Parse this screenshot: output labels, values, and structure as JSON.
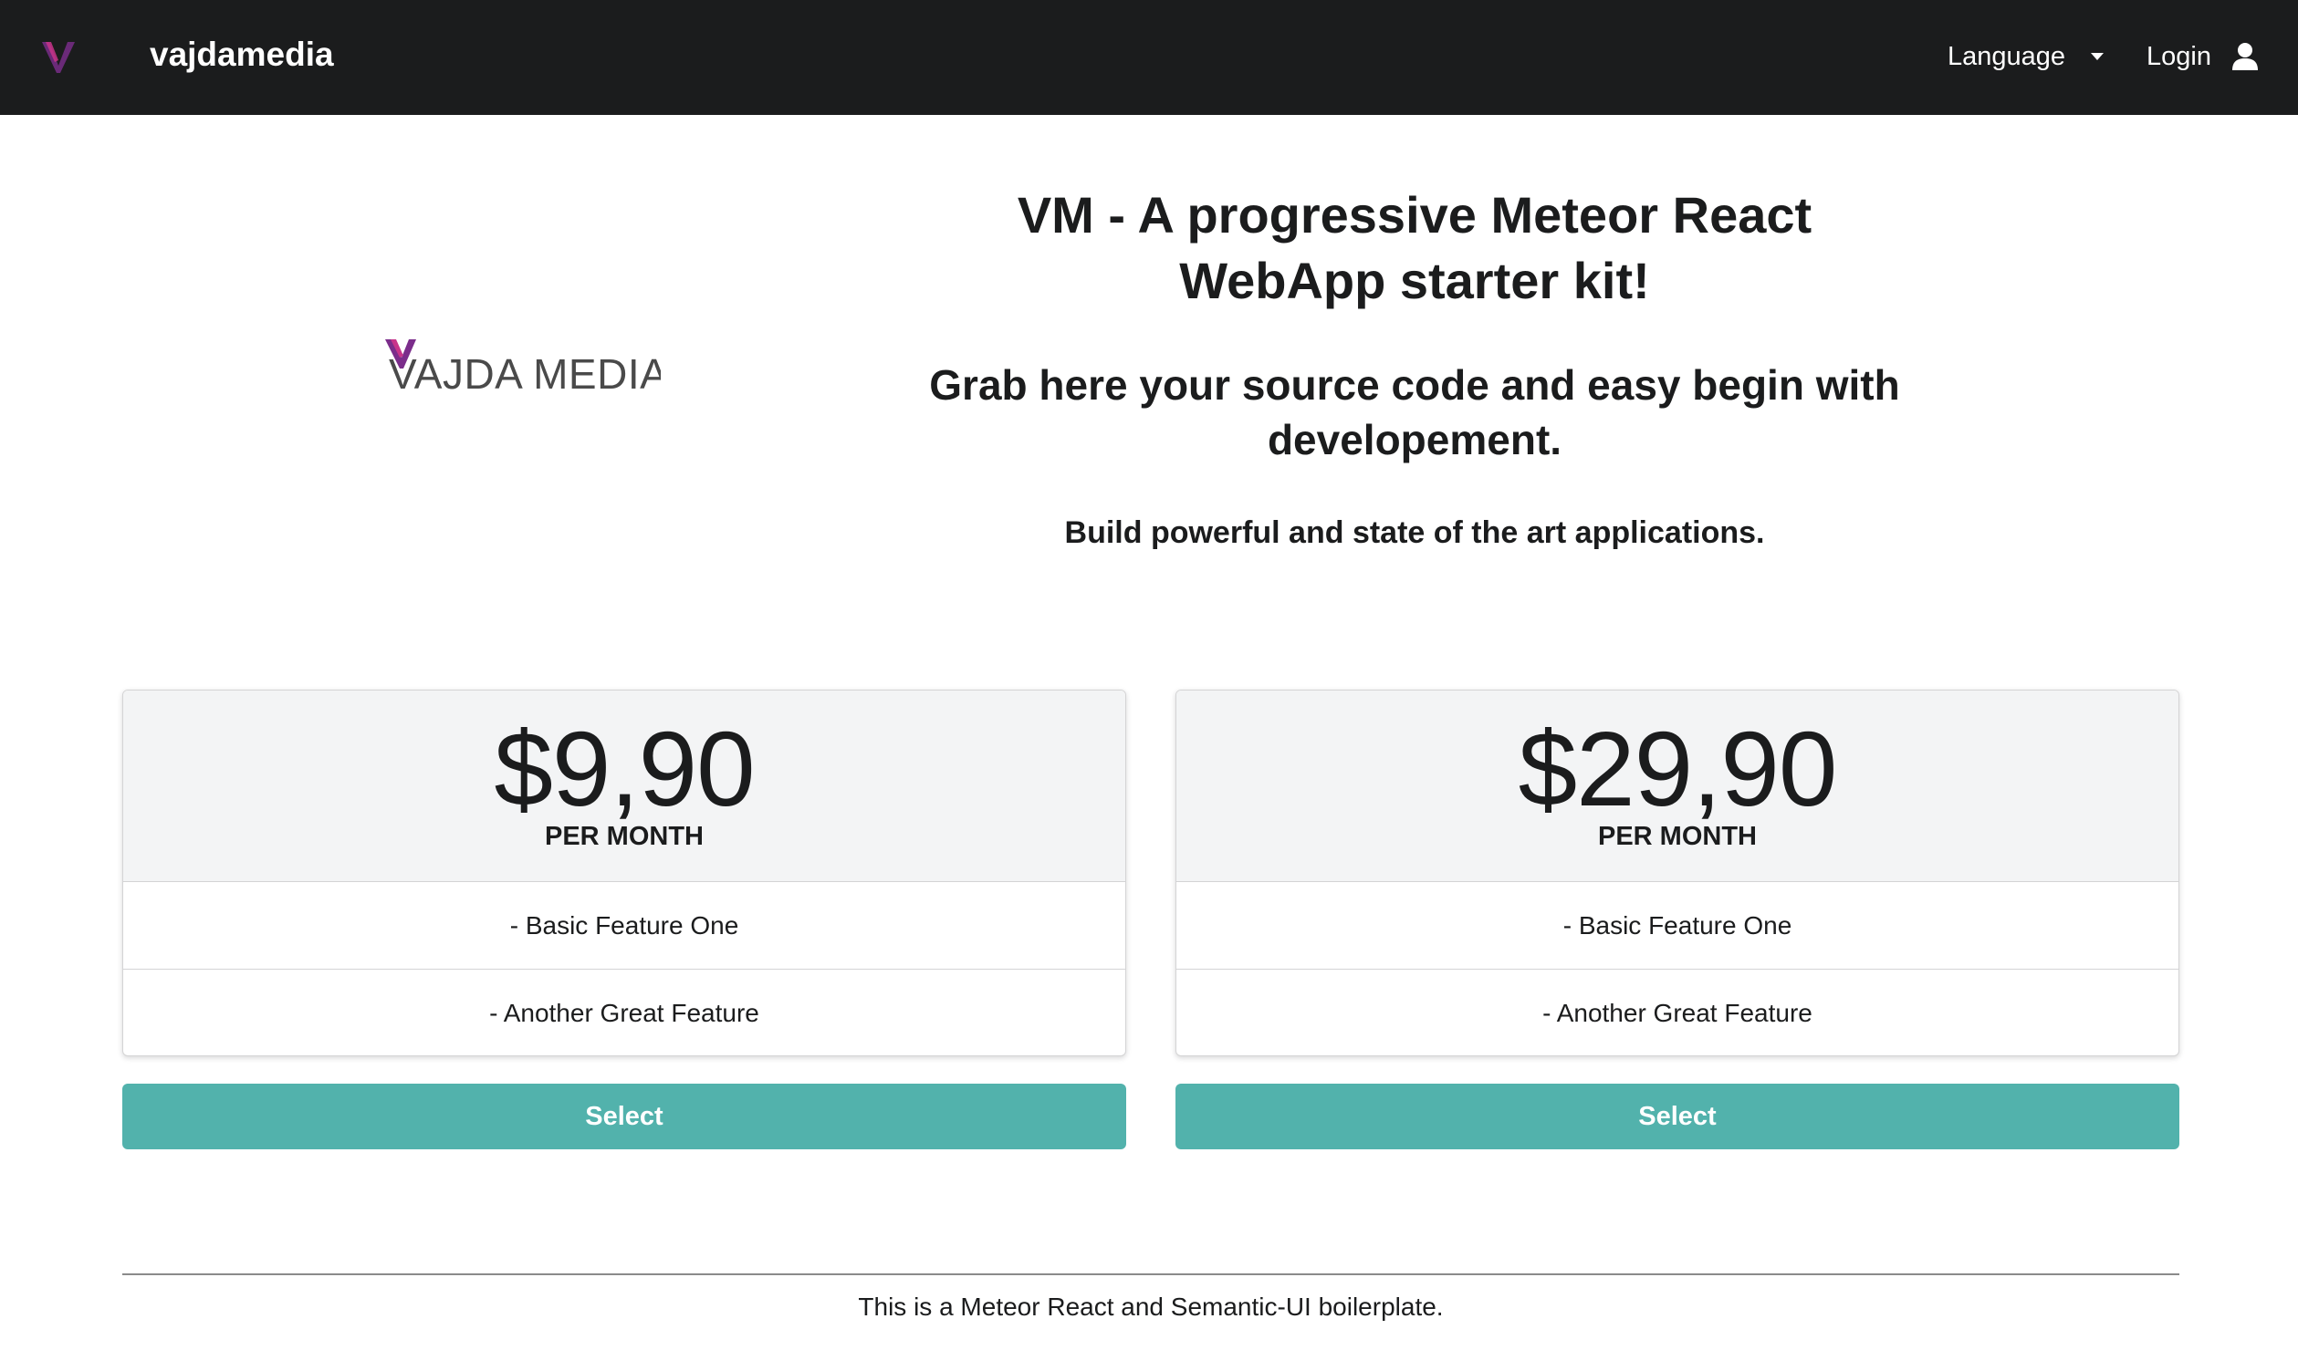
{
  "navbar": {
    "logo_icon": "vm-logo-icon",
    "brand": "vajdamedia",
    "language_label": "Language",
    "language_icon": "caret-down-icon",
    "login_label": "Login",
    "login_icon": "user-icon"
  },
  "hero": {
    "logo_text": "VAJDA MEDIA",
    "title": "VM - A progressive Meteor React WebApp starter kit!",
    "subtitle": "Grab here your source code and easy begin with developement.",
    "tagline": "Build powerful and state of the art applications."
  },
  "pricing": [
    {
      "price": "$9,90",
      "period": "PER MONTH",
      "features": [
        "- Basic Feature One",
        "- Another Great Feature"
      ],
      "button": "Select"
    },
    {
      "price": "$29,90",
      "period": "PER MONTH",
      "features": [
        "- Basic Feature One",
        "- Another Great Feature"
      ],
      "button": "Select"
    }
  ],
  "footer": {
    "text": "This is a Meteor React and Semantic-UI boilerplate."
  },
  "colors": {
    "navbar": "#1b1c1d",
    "accent_teal": "#52b2ac",
    "logo_purple": "#7b2d8b",
    "logo_pink": "#c8348a",
    "card_header_bg": "#f3f4f5"
  }
}
